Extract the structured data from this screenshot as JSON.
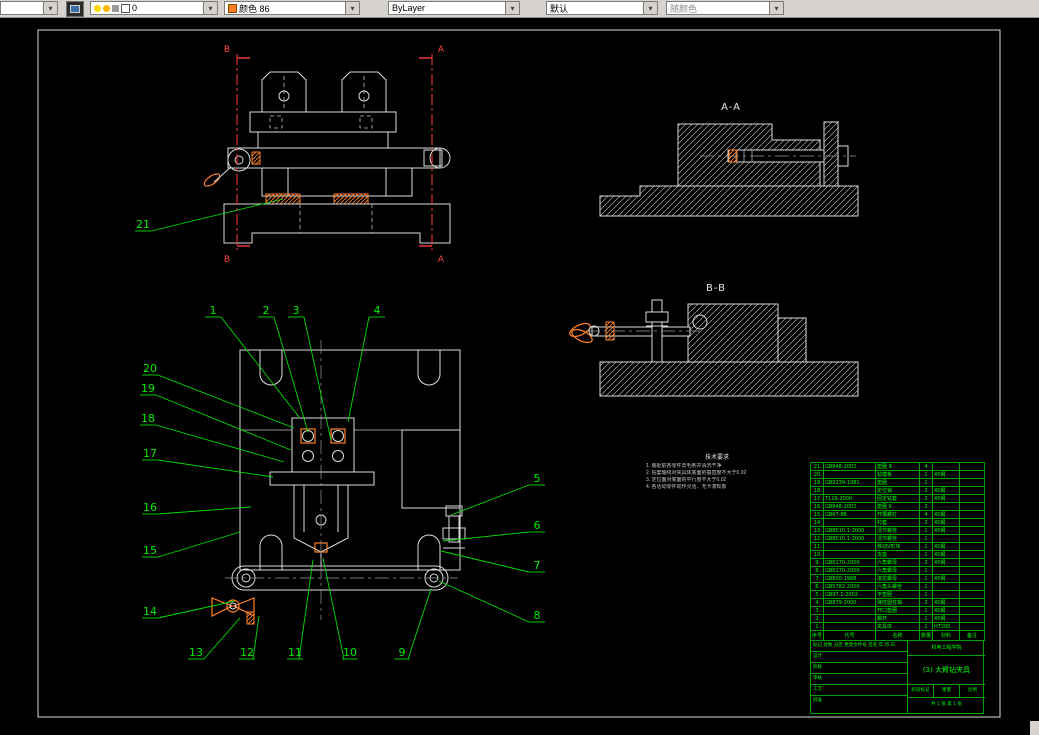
{
  "icons": {
    "dropdown": "▾"
  },
  "toolbar": {
    "layer_combo": {
      "value": "0"
    },
    "color_combo": {
      "value": "颜色 86"
    },
    "linetype_combo": {
      "value": "ByLayer"
    },
    "lineweight_combo": {
      "value": "默认"
    },
    "plotstyle_combo": {
      "value": "随颜色"
    }
  },
  "drawing": {
    "section_view_labels": {
      "aa": "A-A",
      "bb": "B-B"
    },
    "section_letters": {
      "a": "A",
      "b": "B"
    },
    "callouts": [
      "1",
      "2",
      "3",
      "4",
      "5",
      "6",
      "7",
      "8",
      "9",
      "10",
      "11",
      "12",
      "13",
      "14",
      "15",
      "16",
      "17",
      "18",
      "19",
      "20",
      "21"
    ]
  },
  "notes": {
    "heading": "技术要求",
    "lines": [
      "1. 装配前各零件去毛刺并清洗干净",
      "2. 钻套轴线对夹具体底面的垂直度不大于0.02",
      "3. 定位面对底面的平行度不大于0.02",
      "4. 各活动零件动作灵活、无卡滞现象"
    ]
  },
  "bom": {
    "headers": [
      "序号",
      "代号",
      "名称",
      "数量",
      "材料",
      "备注"
    ],
    "rows": [
      [
        "21",
        "GB848-2002",
        "垫圈 8",
        "4",
        "",
        ""
      ],
      [
        "20",
        "",
        "钻模板",
        "1",
        "45钢",
        ""
      ],
      [
        "19",
        "GB9239-1981",
        "垫圈",
        "1",
        "",
        ""
      ],
      [
        "18",
        "",
        "定位销",
        "2",
        "45钢",
        ""
      ],
      [
        "17",
        "T119-2000",
        "固定钻套",
        "2",
        "45钢",
        ""
      ],
      [
        "16",
        "GB848-2002",
        "垫圈 6",
        "2",
        "",
        ""
      ],
      [
        "15",
        "GB67-88",
        "开槽螺钉",
        "4",
        "45钢",
        ""
      ],
      [
        "14",
        "",
        "衬套",
        "2",
        "45钢",
        ""
      ],
      [
        "13",
        "GB8010.1-2000",
        "活节螺栓",
        "1",
        "45钢",
        ""
      ],
      [
        "12",
        "GB8010.1-2000",
        "活节螺栓",
        "1",
        "",
        ""
      ],
      [
        "11",
        "",
        "移动V形块",
        "1",
        "45钢",
        ""
      ],
      [
        "10",
        "",
        "支座",
        "1",
        "45钢",
        ""
      ],
      [
        "9",
        "GB6170-2000",
        "六角螺母",
        "2",
        "45钢",
        ""
      ],
      [
        "8",
        "GB6170-2000",
        "六角螺母",
        "1",
        "",
        ""
      ],
      [
        "7",
        "GB800-1988",
        "滚花螺母",
        "1",
        "45钢",
        ""
      ],
      [
        "6",
        "GB5782-2000",
        "六角头螺栓",
        "1",
        "",
        ""
      ],
      [
        "5",
        "GB97.1-2002",
        "平垫圈",
        "1",
        "",
        ""
      ],
      [
        "4",
        "GB879-2000",
        "弹性圆柱销",
        "2",
        "45钢",
        ""
      ],
      [
        "3",
        "",
        "开口垫圈",
        "1",
        "45钢",
        ""
      ],
      [
        "2",
        "",
        "螺杆",
        "1",
        "45钢",
        ""
      ],
      [
        "1",
        "",
        "夹具体",
        "1",
        "HT200",
        ""
      ]
    ]
  },
  "title_block": {
    "school": "机电工程学院",
    "drawing_title": "(3) 大臂钻夹具",
    "rows_left": [
      "标记 处数 分区 更改文件号 签名 年.月.日",
      "设计",
      "校核",
      "审核",
      "工艺",
      "批准"
    ],
    "stage_label": "阶段标记",
    "weight_label": "重量",
    "scale_label": "比例",
    "sheet_info": "共 1 张  第 1 张"
  }
}
